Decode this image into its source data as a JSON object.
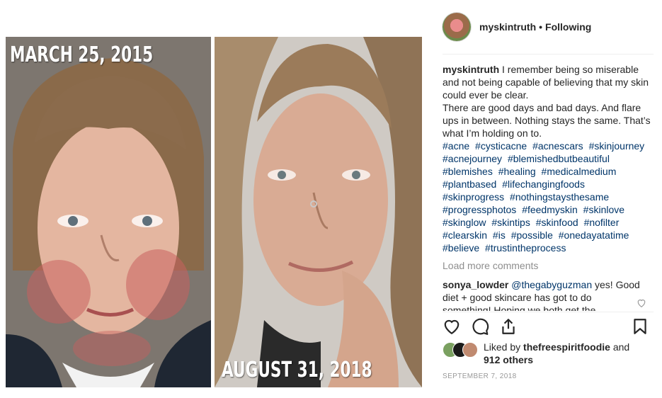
{
  "photo": {
    "left_date": "MARCH 25, 2015",
    "right_date": "AUGUST 31, 2018"
  },
  "post": {
    "username": "myskintruth",
    "separator": "•",
    "follow_status": "Following"
  },
  "caption": {
    "username": "myskintruth",
    "text": "I remember being so miserable and not being capable of believing that my skin could ever be clear.\nThere are good days and bad days. And flare ups in between. Nothing stays the same. That’s what I’m holding on to.",
    "hashtags": [
      "#acne",
      "#cysticacne",
      "#acnescars",
      "#skinjourney",
      "#acnejourney",
      "#blemishedbutbeautiful",
      "#blemishes",
      "#healing",
      "#medicalmedium",
      "#plantbased",
      "#lifechangingfoods",
      "#skinprogress",
      "#nothingstaysthesame",
      "#progressphotos",
      "#feedmyskin",
      "#skinlove",
      "#skinglow",
      "#skintips",
      "#skinfood",
      "#nofilter",
      "#clearskin",
      "#is",
      "#possible",
      "#onedayatatime",
      "#believe",
      "#trustintheprocess"
    ]
  },
  "comments": {
    "load_more_label": "Load more comments",
    "reply": {
      "username": "sonya_lowder",
      "mention": "@thegabyguzman",
      "text": "yes! Good diet + good skincare has got to do something! Hoping we both get the"
    }
  },
  "actions": {
    "icons": [
      "heart-icon",
      "comment-icon",
      "share-icon",
      "bookmark-icon"
    ]
  },
  "likes": {
    "prefix": "Liked by",
    "username": "thefreespiritfoodie",
    "suffix": "and",
    "others": "912 others"
  },
  "post_date": "SEPTEMBER 7, 2018",
  "colors": {
    "text": "#262626",
    "link": "#003569",
    "muted": "#8e8e8e",
    "divider": "#efefef"
  }
}
